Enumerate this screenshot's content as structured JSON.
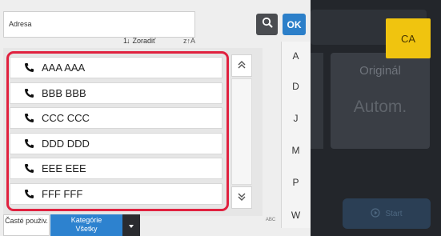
{
  "background": {
    "card_title": "Originál",
    "card_value": "Autom.",
    "ca_label": "CA",
    "start_label": "Start"
  },
  "address": {
    "label": "Adresa",
    "value": "",
    "ok_label": "OK"
  },
  "sort": {
    "label": "Zoradiť",
    "glyph": "1↓",
    "az_glyph": "z↑A"
  },
  "contacts": [
    {
      "name": "AAA AAA"
    },
    {
      "name": "BBB BBB"
    },
    {
      "name": "CCC CCC"
    },
    {
      "name": "DDD DDD"
    },
    {
      "name": "EEE EEE"
    },
    {
      "name": "FFF FFF"
    }
  ],
  "index": [
    "A",
    "D",
    "J",
    "M",
    "P",
    "W"
  ],
  "tabs": {
    "frequent": "Časté použiv.",
    "category_title": "Kategórie",
    "category_value": "Všetky",
    "abc": "ABC"
  },
  "colors": {
    "accent": "#2c7fc9",
    "highlight": "#e0213f",
    "ca": "#f0c40f"
  }
}
